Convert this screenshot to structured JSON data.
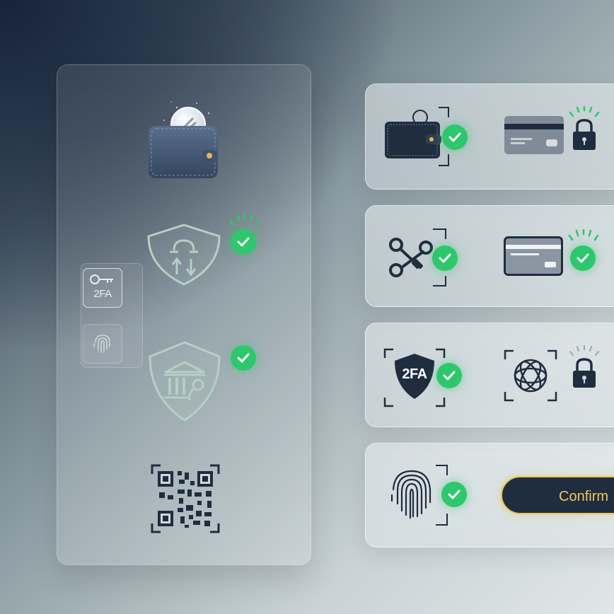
{
  "left_panel": {
    "mini_2fa_label": "2FA"
  },
  "cards": {
    "card_3_2fa_label": "2FA"
  },
  "confirm_button": {
    "label": "Confirm"
  },
  "icons": {
    "wallet": "wallet-coin-icon",
    "shield_transfer": "shield-transfer-icon",
    "shield_bank": "shield-bank-icon",
    "qr": "qr-code-icon",
    "key_2fa": "key-2fa-icon",
    "fingerprint": "fingerprint-icon",
    "check": "check-circle-icon",
    "lock": "lock-icon",
    "card": "credit-card-icon",
    "keys": "keys-icon",
    "face_scan": "face-scan-icon"
  },
  "colors": {
    "success": "#2ec76e",
    "navy": "#1f2d3f",
    "gold": "#e8c35a"
  }
}
